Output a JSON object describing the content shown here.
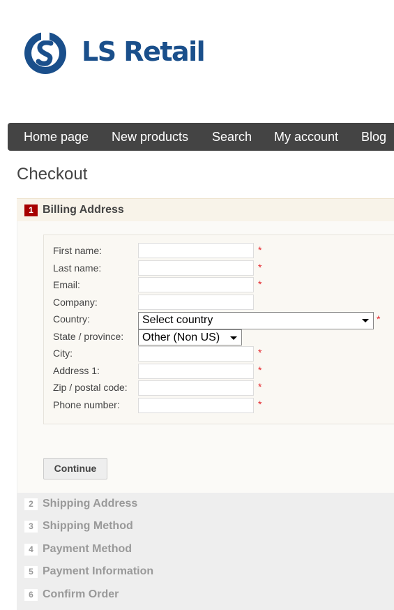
{
  "logo": {
    "text": "LS Retail"
  },
  "nav": {
    "items": [
      "Home page",
      "New products",
      "Search",
      "My account",
      "Blog"
    ]
  },
  "page": {
    "title": "Checkout"
  },
  "steps": [
    {
      "num": "1",
      "label": "Billing Address"
    },
    {
      "num": "2",
      "label": "Shipping Address"
    },
    {
      "num": "3",
      "label": "Shipping Method"
    },
    {
      "num": "4",
      "label": "Payment Method"
    },
    {
      "num": "5",
      "label": "Payment Information"
    },
    {
      "num": "6",
      "label": "Confirm Order"
    }
  ],
  "form": {
    "labels": {
      "first_name": "First name:",
      "last_name": "Last name:",
      "email": "Email:",
      "company": "Company:",
      "country": "Country:",
      "state": "State / province:",
      "city": "City:",
      "address1": "Address 1:",
      "zip": "Zip / postal code:",
      "phone": "Phone number:"
    },
    "required_mark": "*",
    "country_value": "Select country",
    "state_value": "Other (Non US)",
    "continue_label": "Continue"
  },
  "colors": {
    "accent": "#a60000",
    "nav_bg": "#444444",
    "logo_blue": "#1a4f8b",
    "required": "#e4252b"
  }
}
